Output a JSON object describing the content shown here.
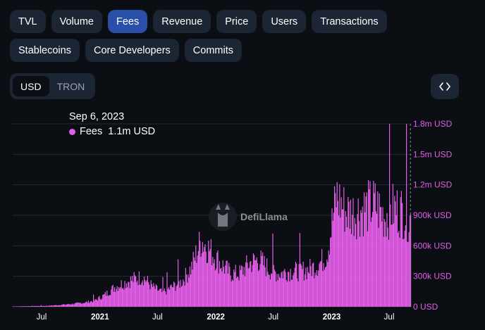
{
  "metric_tabs": [
    {
      "label": "TVL",
      "active": false
    },
    {
      "label": "Volume",
      "active": false
    },
    {
      "label": "Fees",
      "active": true
    },
    {
      "label": "Revenue",
      "active": false
    },
    {
      "label": "Price",
      "active": false
    },
    {
      "label": "Users",
      "active": false
    },
    {
      "label": "Transactions",
      "active": false
    },
    {
      "label": "Stablecoins",
      "active": false
    },
    {
      "label": "Core Developers",
      "active": false
    },
    {
      "label": "Commits",
      "active": false
    }
  ],
  "denomination": {
    "options": [
      {
        "label": "USD",
        "active": true
      },
      {
        "label": "TRON",
        "active": false
      }
    ]
  },
  "embed_button": {
    "icon": "code-icon"
  },
  "tooltip": {
    "date": "Sep 6, 2023",
    "series_name": "Fees",
    "value": "1.1m USD",
    "color": "#e35ee8"
  },
  "watermark": {
    "text": "DefiLlama"
  },
  "colors": {
    "series": "#e35ee8",
    "accent": "#2a4fa8",
    "background": "#0b0e13"
  },
  "chart_data": {
    "type": "bar",
    "title": "",
    "ylabel": "",
    "xlabel": "",
    "ylim": [
      0,
      1800000
    ],
    "xlim": [
      "2020-04-01",
      "2023-09-10"
    ],
    "grid": true,
    "y_axis_position": "right",
    "y_ticks": [
      "0 USD",
      "300k USD",
      "600k USD",
      "900k USD",
      "1.2m USD",
      "1.5m USD",
      "1.8m USD"
    ],
    "y_tick_values": [
      0,
      300000,
      600000,
      900000,
      1200000,
      1500000,
      1800000
    ],
    "x_ticks": [
      {
        "label": "Jul",
        "date": "2020-07-01",
        "bold": false
      },
      {
        "label": "2021",
        "date": "2021-01-01",
        "bold": true
      },
      {
        "label": "Jul",
        "date": "2021-07-01",
        "bold": false
      },
      {
        "label": "2022",
        "date": "2022-01-01",
        "bold": true
      },
      {
        "label": "Jul",
        "date": "2022-07-01",
        "bold": false
      },
      {
        "label": "2023",
        "date": "2023-01-01",
        "bold": true
      },
      {
        "label": "Jul",
        "date": "2023-07-01",
        "bold": false
      }
    ],
    "series": [
      {
        "name": "Fees",
        "color": "#e35ee8",
        "points": [
          [
            "2020-04-15",
            5000
          ],
          [
            "2020-05-15",
            8000
          ],
          [
            "2020-06-15",
            10000
          ],
          [
            "2020-07-15",
            12000
          ],
          [
            "2020-08-15",
            20000
          ],
          [
            "2020-09-15",
            30000
          ],
          [
            "2020-10-15",
            40000
          ],
          [
            "2020-11-15",
            55000
          ],
          [
            "2020-12-15",
            80000
          ],
          [
            "2021-01-15",
            150000
          ],
          [
            "2021-02-15",
            250000
          ],
          [
            "2021-03-15",
            300000
          ],
          [
            "2021-04-15",
            350000
          ],
          [
            "2021-05-15",
            380000
          ],
          [
            "2021-06-15",
            250000
          ],
          [
            "2021-07-15",
            180000
          ],
          [
            "2021-08-15",
            250000
          ],
          [
            "2021-09-15",
            320000
          ],
          [
            "2021-10-15",
            500000
          ],
          [
            "2021-11-15",
            850000
          ],
          [
            "2021-12-15",
            700000
          ],
          [
            "2022-01-15",
            550000
          ],
          [
            "2022-02-15",
            420000
          ],
          [
            "2022-03-15",
            420000
          ],
          [
            "2022-04-15",
            550000
          ],
          [
            "2022-05-15",
            600000
          ],
          [
            "2022-06-15",
            480000
          ],
          [
            "2022-07-15",
            420000
          ],
          [
            "2022-08-15",
            450000
          ],
          [
            "2022-09-15",
            450000
          ],
          [
            "2022-10-15",
            470000
          ],
          [
            "2022-11-15",
            520000
          ],
          [
            "2022-12-15",
            650000
          ],
          [
            "2023-01-15",
            1400000
          ],
          [
            "2023-02-15",
            1200000
          ],
          [
            "2023-03-15",
            1200000
          ],
          [
            "2023-04-15",
            1250000
          ],
          [
            "2023-05-15",
            1300000
          ],
          [
            "2023-06-15",
            1150000
          ],
          [
            "2023-07-15",
            1250000
          ],
          [
            "2023-08-15",
            1200000
          ],
          [
            "2023-09-06",
            1100000
          ]
        ]
      }
    ]
  }
}
